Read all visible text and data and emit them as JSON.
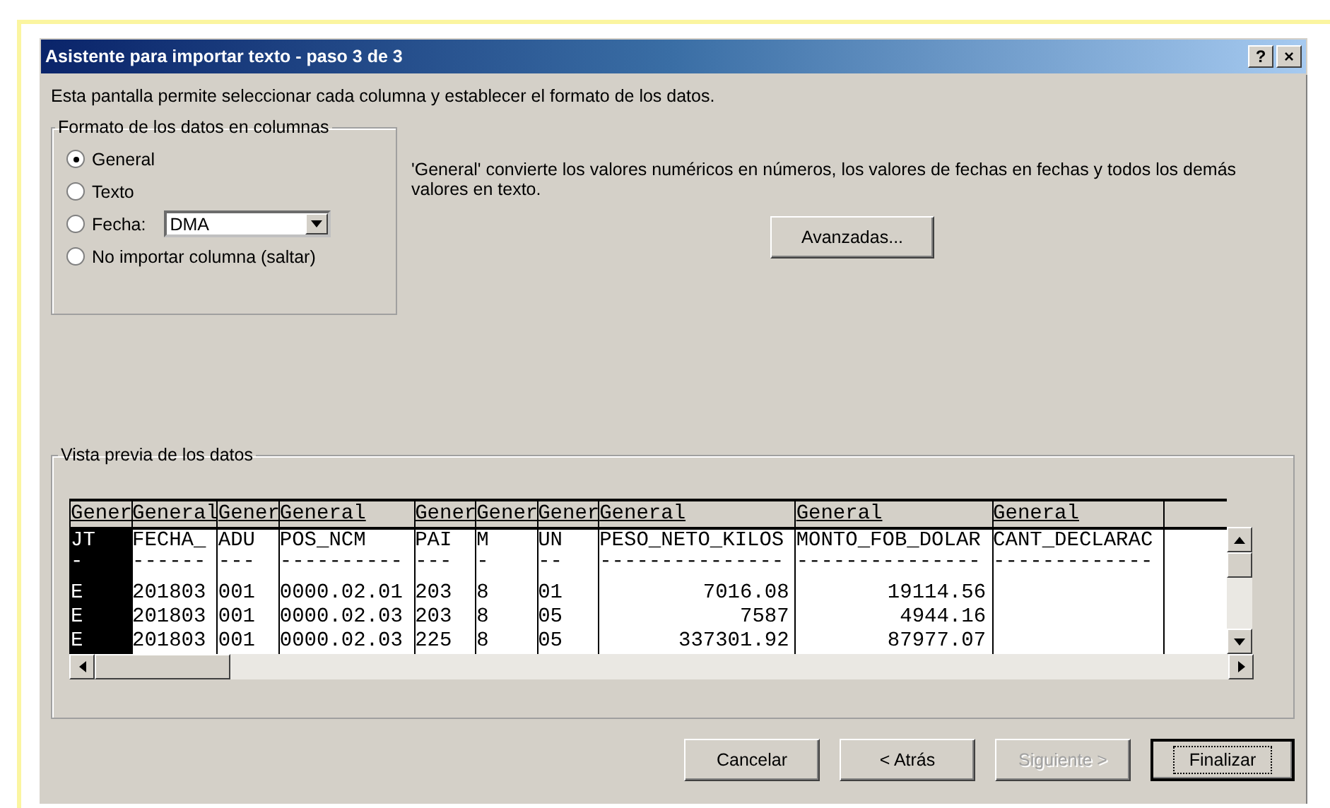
{
  "window": {
    "title": "Asistente para importar texto - paso 3 de 3",
    "buttons": [
      "?",
      "×"
    ]
  },
  "intro": "Esta pantalla permite seleccionar cada columna y establecer el formato de los datos.",
  "format_group": {
    "title": "Formato de los datos en columnas",
    "options": [
      {
        "label": "General",
        "selected": true
      },
      {
        "label": "Texto",
        "selected": false
      },
      {
        "label": "Fecha:",
        "selected": false,
        "dropdown": "DMA"
      },
      {
        "label": "No importar columna (saltar)",
        "selected": false
      }
    ]
  },
  "description": "'General' convierte los valores numéricos en números, los valores de fechas en fechas y todos los demás valores en texto.",
  "advanced_button": "Avanzadas...",
  "preview": {
    "title": "Vista previa de los datos",
    "columns": [
      {
        "header": "Gener",
        "selected": true,
        "numeric": false
      },
      {
        "header": "General",
        "selected": false,
        "numeric": false
      },
      {
        "header": "Gener",
        "selected": false,
        "numeric": false
      },
      {
        "header": "General",
        "selected": false,
        "numeric": false
      },
      {
        "header": "Gener",
        "selected": false,
        "numeric": false
      },
      {
        "header": "Gener",
        "selected": false,
        "numeric": false
      },
      {
        "header": "Gener",
        "selected": false,
        "numeric": false
      },
      {
        "header": "General",
        "selected": false,
        "numeric": true
      },
      {
        "header": "General",
        "selected": false,
        "numeric": true
      },
      {
        "header": "General",
        "selected": false
      }
    ],
    "rows": [
      {
        "kind": "header",
        "cells": [
          "JT",
          "FECHA_",
          "ADU",
          "POS_NCM",
          "PAI",
          "M",
          "UN",
          "PESO_NETO_KILOS",
          "MONTO_FOB_DOLAR",
          "CANT_DECLARAC"
        ]
      },
      {
        "kind": "rule",
        "cells": [
          "-",
          "------",
          "---",
          "----------",
          "---",
          "-",
          "--",
          "---------------",
          "---------------",
          "-------------"
        ]
      },
      {
        "kind": "data",
        "cells": [
          "E",
          "201803",
          "001",
          "0000.02.01",
          "203",
          "8",
          "01",
          "7016.08",
          "19114.56",
          ""
        ]
      },
      {
        "kind": "data",
        "cells": [
          "E",
          "201803",
          "001",
          "0000.02.03",
          "203",
          "8",
          "05",
          "7587",
          "4944.16",
          ""
        ]
      },
      {
        "kind": "data",
        "cells": [
          "E",
          "201803",
          "001",
          "0000.02.03",
          "225",
          "8",
          "05",
          "337301.92",
          "87977.07",
          ""
        ]
      }
    ]
  },
  "footer_buttons": [
    {
      "label": "Cancelar",
      "disabled": false,
      "default": false
    },
    {
      "label": "< Atrás",
      "disabled": false,
      "default": false
    },
    {
      "label": "Siguiente >",
      "disabled": true,
      "default": false
    },
    {
      "label": "Finalizar",
      "disabled": false,
      "default": true
    }
  ]
}
